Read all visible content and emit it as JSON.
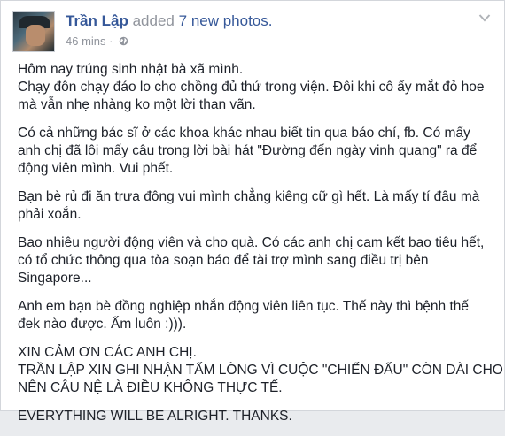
{
  "post": {
    "author": "Trần Lập",
    "action_text": "added",
    "count": "7",
    "object_text": "new photos.",
    "time": "46 mins",
    "separator": "·",
    "privacy_icon": "globe-icon",
    "menu_icon": "chevron-down-icon",
    "paragraphs": [
      [
        "Hôm nay trúng sinh nhật bà xã mình.",
        "Chạy đôn chạy đáo lo cho chồng đủ thứ trong viện. Đôi khi cô ấy mắt đỏ hoe",
        "mà vẫn nhẹ nhàng ko một lời than vãn."
      ],
      [
        "Có cả những bác sĩ ở các khoa khác nhau biết tin qua báo chí, fb. Có mấy",
        "anh chị đã lôi mấy câu trong lời bài hát \"Đường đến ngày vinh quang\" ra để",
        "động viên mình. Vui phết."
      ],
      [
        "Bạn bè rủ đi ăn trưa đông vui mình chẳng kiêng cữ gì hết. Là mấy tí đâu mà",
        "phải xoắn."
      ],
      [
        "Bao nhiêu người động viên và cho quà. Có các anh chị cam kết bao tiêu hết,",
        "có tổ chức thông qua tòa soạn báo để tài trợ mình sang điều trị bên",
        "Singapore..."
      ],
      [
        "Anh em bạn bè đồng nghiệp nhắn động viên liên tục. Thế này thì bệnh thế",
        "đek nào được. Ấm luôn :)))."
      ],
      [
        "XIN CẢM ƠN CÁC ANH CHỊ.",
        "TRẦN LẬP XIN GHI NHẬN TẤM LÒNG VÌ CUỘC \"CHIẾN ĐẤU\" CÒN DÀI CHO",
        "NÊN CÂU NỆ LÀ ĐIỀU KHÔNG THỰC TẾ."
      ],
      [
        "EVERYTHING WILL BE ALRIGHT. THANKS."
      ]
    ]
  }
}
